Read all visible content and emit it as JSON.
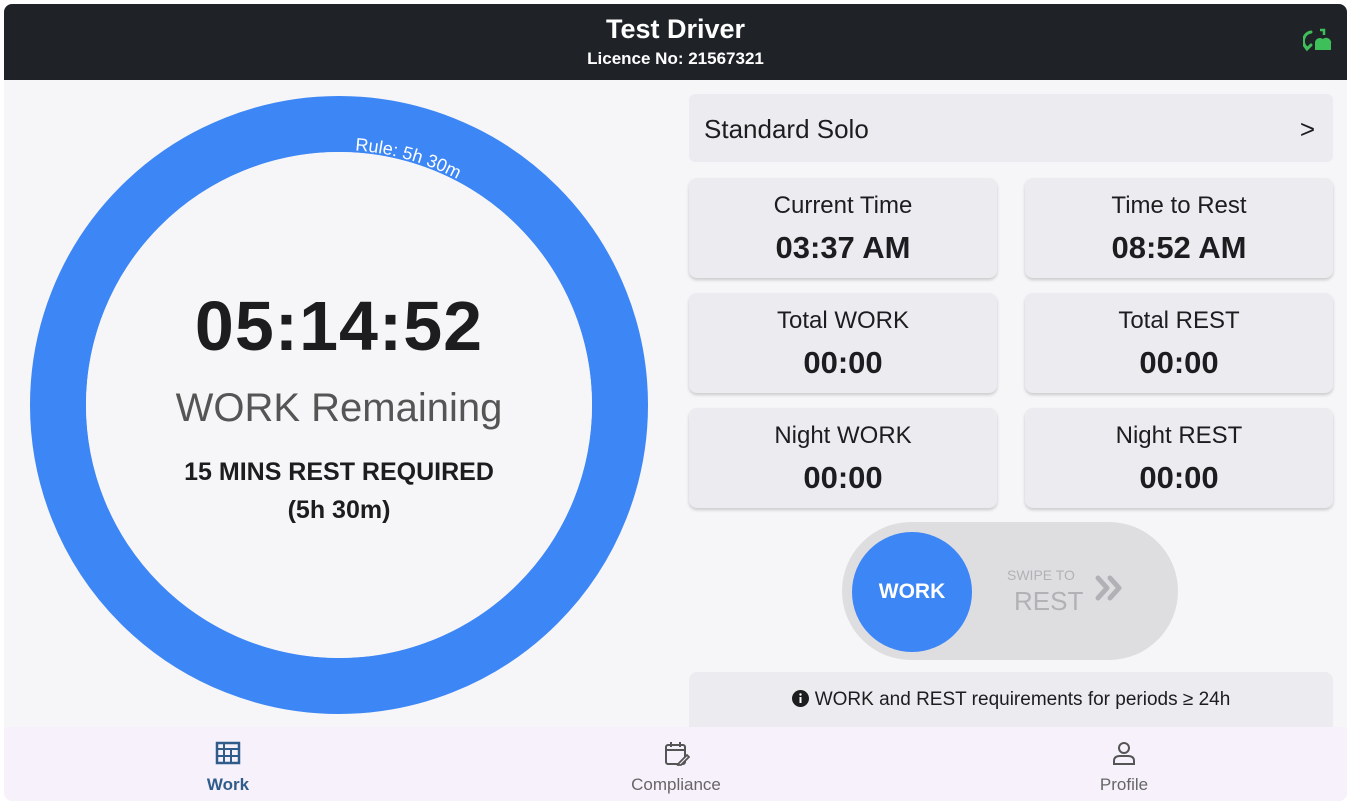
{
  "header": {
    "title": "Test Driver",
    "licence": "Licence No: 21567321",
    "sync_icon": "cloud-sync-icon"
  },
  "ring": {
    "rule_label": "Rule: 5h 30m",
    "timer": "05:14:52",
    "status": "WORK Remaining",
    "rest_required": "15 MINS REST REQUIRED",
    "rest_sub": "(5h 30m)",
    "color": "#3d86f5"
  },
  "rule_select": {
    "label": "Standard Solo",
    "chevron": ">"
  },
  "stats": [
    {
      "label": "Current Time",
      "value": "03:37 AM"
    },
    {
      "label": "Time to Rest",
      "value": "08:52 AM"
    },
    {
      "label": "Total WORK",
      "value": "00:00"
    },
    {
      "label": "Total REST",
      "value": "00:00"
    },
    {
      "label": "Night WORK",
      "value": "00:00"
    },
    {
      "label": "Night REST",
      "value": "00:00"
    }
  ],
  "swipe": {
    "knob_label": "WORK",
    "hint": "SWIPE TO",
    "target": "REST"
  },
  "info": {
    "text": "WORK and REST requirements for periods ≥ 24h"
  },
  "nav": {
    "items": [
      {
        "label": "Work",
        "icon": "work-grid-icon",
        "active": true
      },
      {
        "label": "Compliance",
        "icon": "calendar-edit-icon",
        "active": false
      },
      {
        "label": "Profile",
        "icon": "person-icon",
        "active": false
      }
    ]
  },
  "colors": {
    "header_bg": "#1f2328",
    "accent": "#3d86f5",
    "sync_green": "#3fbf5a",
    "nav_active": "#2f5c8a"
  }
}
